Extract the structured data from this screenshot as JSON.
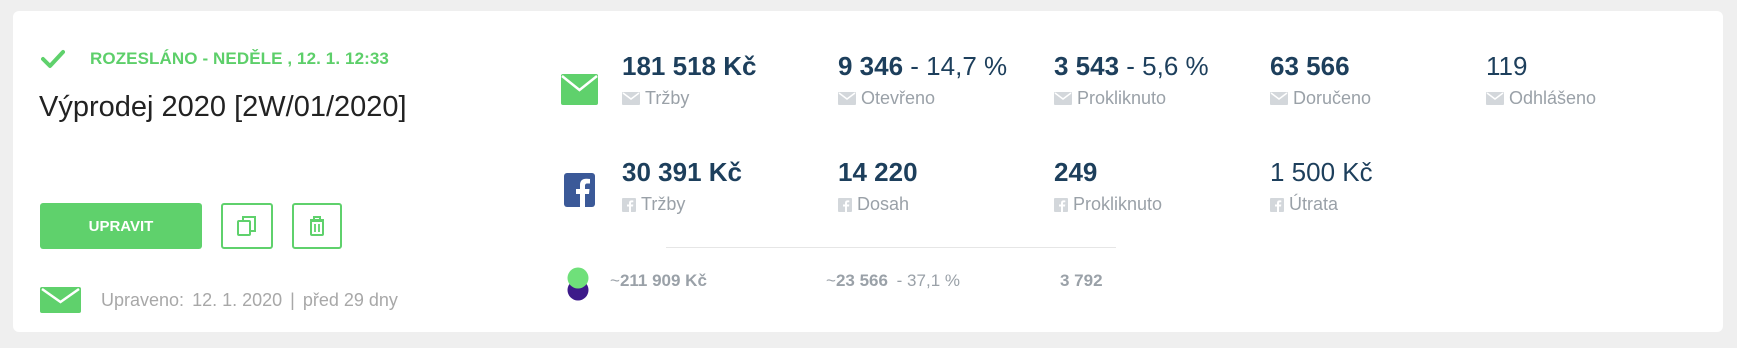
{
  "campaign": {
    "status_text": "ROZESLÁNO - NEDĚLE , 12. 1. 12:33",
    "title": "Výprodej 2020 [2W/01/2020]",
    "edit_button": "UPRAVIT",
    "edited_label": "Upraveno:",
    "edited_date": "12. 1. 2020",
    "edited_separator": "|",
    "edited_ago": "před 29 dny"
  },
  "email_stats": [
    {
      "value": "181 518 Kč",
      "pct": "",
      "label": "Tržby"
    },
    {
      "value": "9 346",
      "pct": " - 14,7 %",
      "label": "Otevřeno"
    },
    {
      "value": "3 543",
      "pct": " - 5,6 %",
      "label": "Prokliknuto"
    },
    {
      "value": "63 566",
      "pct": "",
      "label": "Doručeno"
    },
    {
      "value": "119",
      "pct": "",
      "label": "Odhlášeno"
    }
  ],
  "facebook_stats": [
    {
      "value": "30 391 Kč",
      "label": "Tržby"
    },
    {
      "value": "14 220",
      "label": "Dosah"
    },
    {
      "value": "249",
      "label": "Prokliknuto"
    },
    {
      "value": "1 500 Kč",
      "label": "Útrata"
    }
  ],
  "summary": {
    "revenue_prefix": "~",
    "revenue": "211 909 Kč",
    "reach_prefix": "~",
    "reach": "23 566",
    "reach_pct": "-  37,1 %",
    "clicks": "3 792"
  },
  "colors": {
    "accent_green": "#5fd16c",
    "value_navy": "#1d3f5c",
    "facebook_blue": "#3b5998",
    "combo_purple": "#3d1a8a"
  },
  "icons": {
    "status": "check-icon",
    "email_channel": "envelope-icon",
    "facebook_channel": "facebook-icon",
    "combined_channel": "combined-channel-icon",
    "copy": "copy-icon",
    "delete": "trash-icon"
  }
}
